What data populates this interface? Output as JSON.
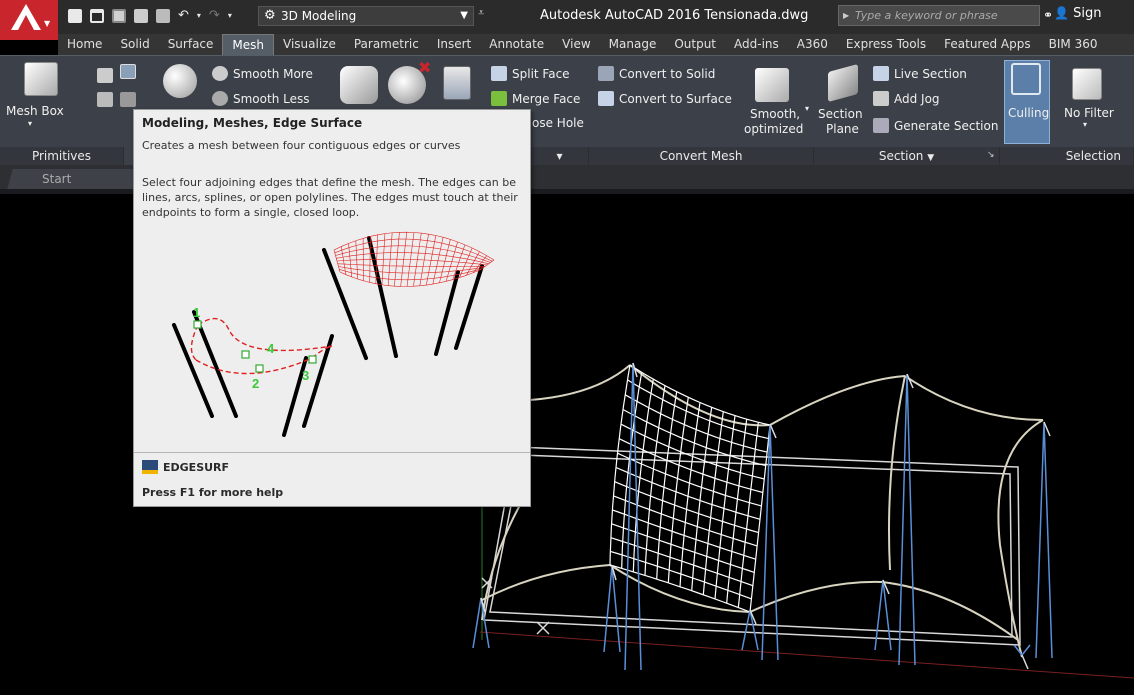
{
  "window": {
    "title": "Autodesk AutoCAD 2016   Tensionada.dwg",
    "workspace": "3D Modeling",
    "search_placeholder": "Type a keyword or phrase",
    "sign_in": "Sign"
  },
  "tabs": [
    "Home",
    "Solid",
    "Surface",
    "Mesh",
    "Visualize",
    "Parametric",
    "Insert",
    "Annotate",
    "View",
    "Manage",
    "Output",
    "Add-ins",
    "A360",
    "Express Tools",
    "Featured Apps",
    "BIM 360"
  ],
  "active_tab": "Mesh",
  "ribbon": {
    "mesh_box": "Mesh Box",
    "smooth_more": "Smooth More",
    "smooth_less": "Smooth Less",
    "split_face": "Split Face",
    "merge_face": "Merge Face",
    "close_hole": "ose Hole",
    "convert_to_solid": "Convert to Solid",
    "convert_to_surface": "Convert to Surface",
    "smooth_optimized_1": "Smooth,",
    "smooth_optimized_2": "optimized",
    "section_plane_1": "Section",
    "section_plane_2": "Plane",
    "live_section": "Live Section",
    "add_jog": "Add Jog",
    "generate_section": "Generate Section",
    "culling": "Culling",
    "no_filter": "No Filter",
    "panels": {
      "primitives": "Primitives",
      "convert_mesh": "Convert Mesh",
      "section": "Section",
      "selection": "Selection"
    }
  },
  "doc_tabs": {
    "start": "Start"
  },
  "tooltip": {
    "title": "Modeling, Meshes, Edge Surface",
    "subtitle": "Creates a mesh between four contiguous edges or curves",
    "description": "Select four adjoining edges that define the mesh. The edges can be lines, arcs, splines, or open polylines. The edges must touch at their endpoints to form a single, closed loop.",
    "labels": [
      "1",
      "2",
      "3",
      "4"
    ],
    "command": "EDGESURF",
    "help": "Press F1 for more help"
  },
  "colors": {
    "accent_red": "#c8262c",
    "ribbon_bg": "#3c4048",
    "culling_active": "#5b7fa8",
    "mesh_line": "#ffffff",
    "edge_line": "#d8d4c0",
    "pole_blue": "#5a8fd8"
  }
}
